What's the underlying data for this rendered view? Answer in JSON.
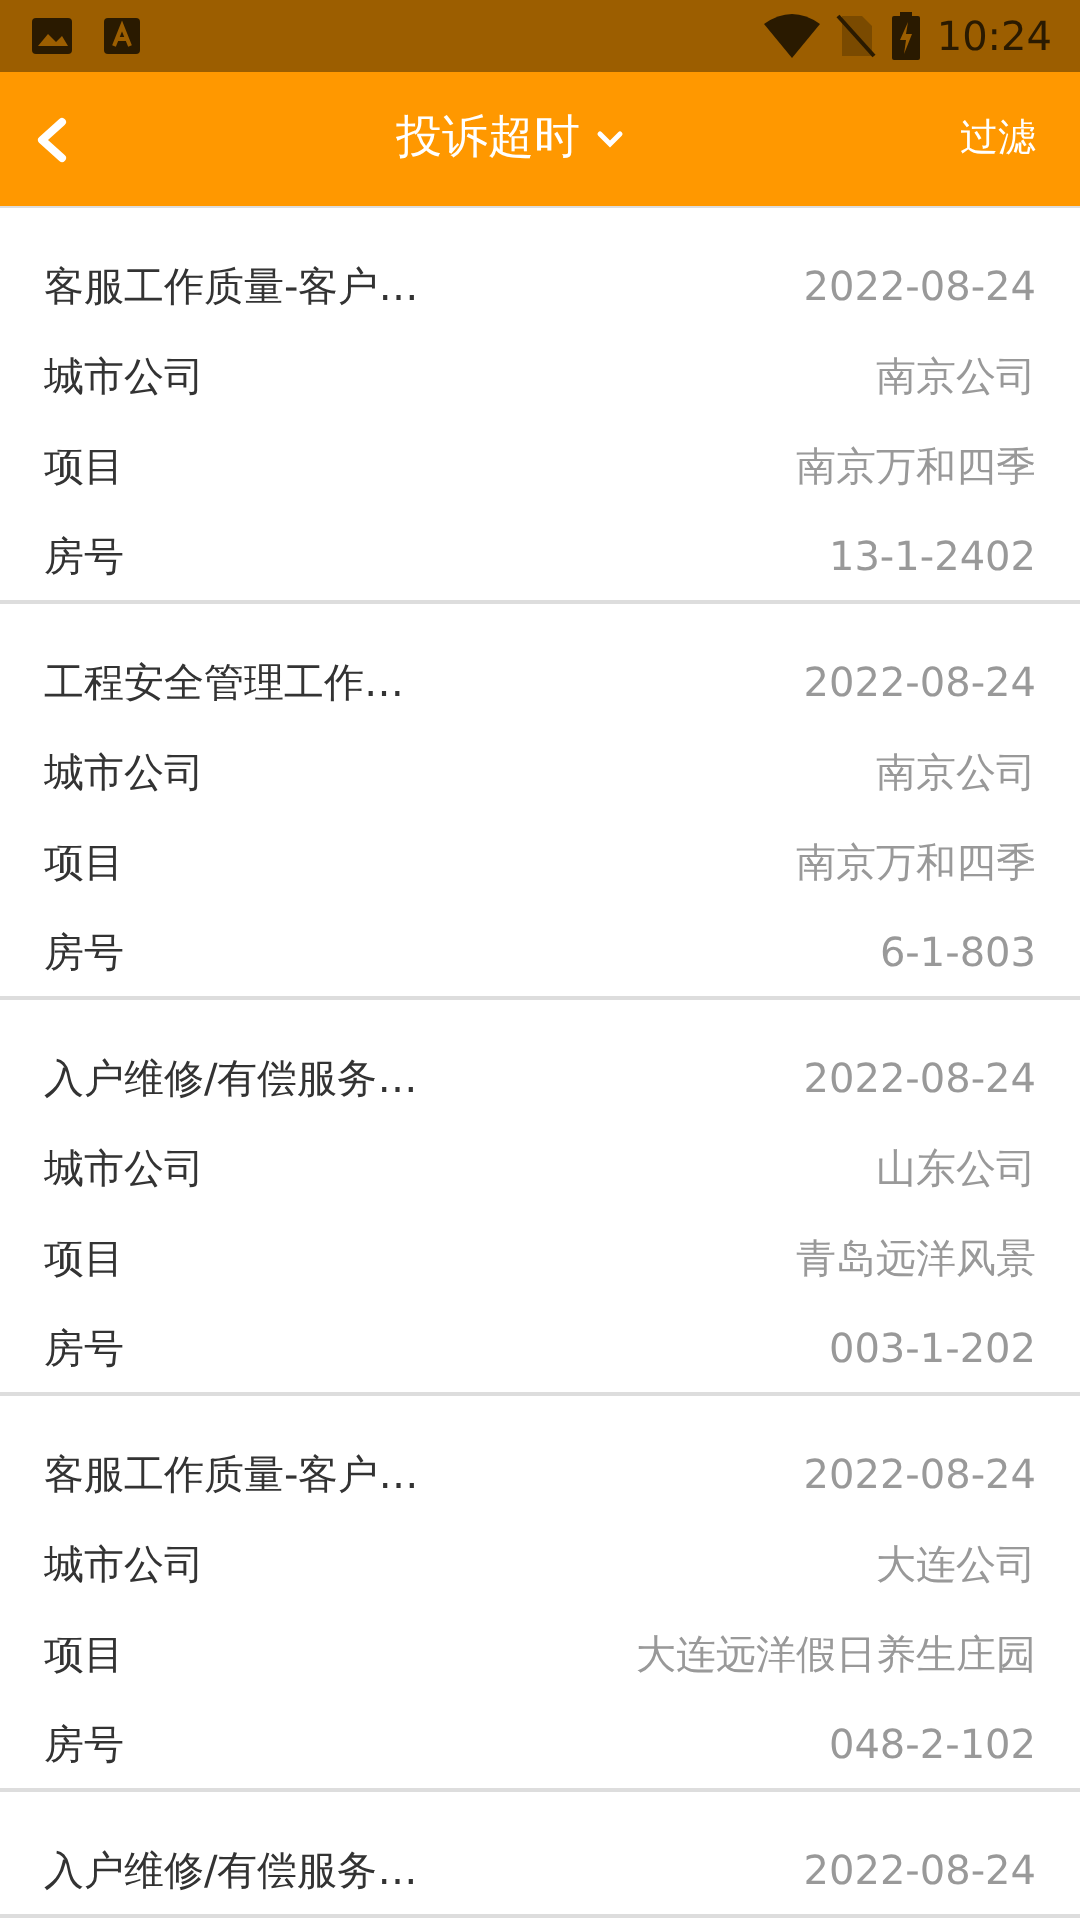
{
  "status_bar": {
    "time": "10:24"
  },
  "header": {
    "title": "投诉超时",
    "filter": "过滤"
  },
  "items": [
    {
      "title": "客服工作质量-客户…",
      "date": "2022-08-24",
      "fields": [
        {
          "label": "城市公司",
          "value": "南京公司"
        },
        {
          "label": "项目",
          "value": "南京万和四季"
        },
        {
          "label": "房号",
          "value": "13-1-2402"
        }
      ]
    },
    {
      "title": "工程安全管理工作…",
      "date": "2022-08-24",
      "fields": [
        {
          "label": "城市公司",
          "value": "南京公司"
        },
        {
          "label": "项目",
          "value": "南京万和四季"
        },
        {
          "label": "房号",
          "value": "6-1-803"
        }
      ]
    },
    {
      "title": "入户维修/有偿服务…",
      "date": "2022-08-24",
      "fields": [
        {
          "label": "城市公司",
          "value": "山东公司"
        },
        {
          "label": "项目",
          "value": "青岛远洋风景"
        },
        {
          "label": "房号",
          "value": "003-1-202"
        }
      ]
    },
    {
      "title": "客服工作质量-客户…",
      "date": "2022-08-24",
      "fields": [
        {
          "label": "城市公司",
          "value": "大连公司"
        },
        {
          "label": "项目",
          "value": "大连远洋假日养生庄园"
        },
        {
          "label": "房号",
          "value": "048-2-102"
        }
      ]
    },
    {
      "title": "入户维修/有偿服务…",
      "date": "2022-08-24"
    }
  ]
}
